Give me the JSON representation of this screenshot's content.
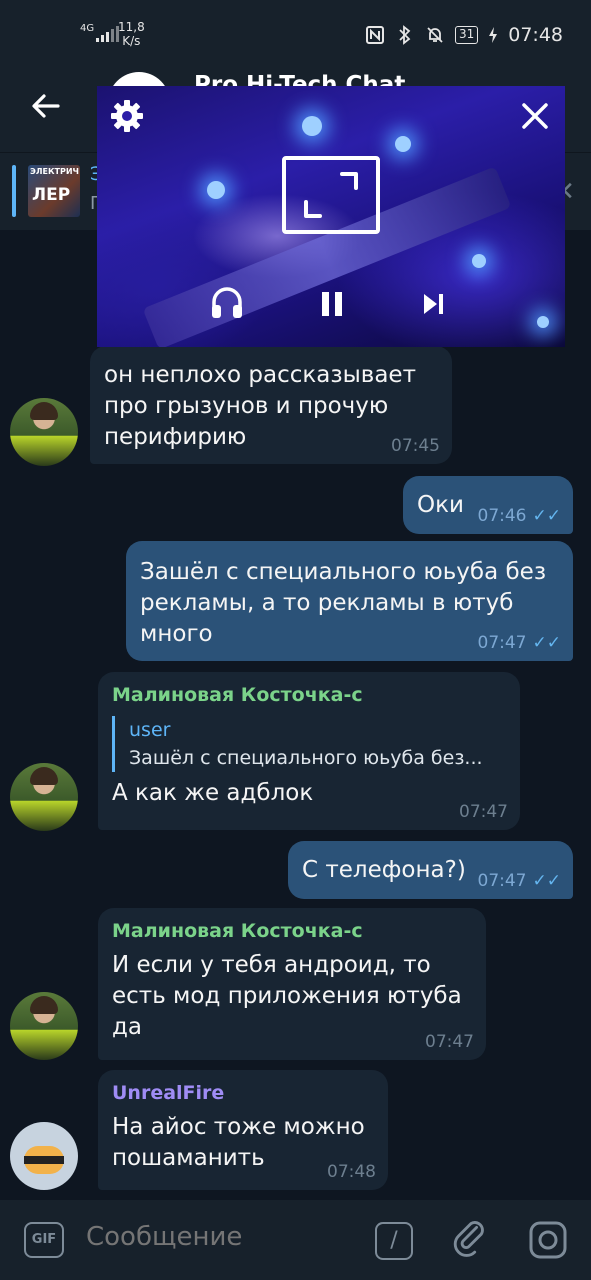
{
  "status_bar": {
    "network": "4G",
    "speed_top": "11,8",
    "speed_bottom": "K/s",
    "battery": "31",
    "time": "07:48"
  },
  "header": {
    "title": "Pro Hi-Tech Chat"
  },
  "pinned": {
    "title": "Э",
    "text": "Г",
    "thumb_top": "ЭЛЕКТРИЧ",
    "thumb_big": "ЛЕР"
  },
  "pip": {
    "icons": [
      "gear-icon",
      "close-icon",
      "expand-icon",
      "headphones-icon",
      "pause-icon",
      "next-icon"
    ]
  },
  "messages": [
    {
      "text": "он неплохо рассказывает про грызунов и прочую перифирию",
      "time": "07:45"
    },
    {
      "text": "Оки",
      "time": "07:46",
      "read": "✓✓"
    },
    {
      "text": "Зашёл с специального юьуба без рекламы, а то рекламы в ютуб много",
      "time": "07:47",
      "read": "✓✓"
    },
    {
      "sender": "Малиновая Косточка-с",
      "reply_name": "user",
      "reply_text": "Зашёл с специального юьуба без...",
      "text": "А как же адблок",
      "time": "07:47"
    },
    {
      "text": "С телефона?)",
      "time": "07:47",
      "read": "✓✓"
    },
    {
      "sender": "Малиновая Косточка-с",
      "text": "И если у тебя андроид, то есть мод приложения ютуба да",
      "time": "07:47"
    },
    {
      "sender": "UnrealFire",
      "text": "На айос тоже можно пошаманить",
      "time": "07:48"
    }
  ],
  "colors": {
    "background": "#0e1621",
    "incoming": "#182533",
    "outgoing": "#2b5278",
    "sender_green": "#7bd38a",
    "sender_purple": "#9f8cf5",
    "accent": "#5eb5f7"
  },
  "input": {
    "gif_label": "GIF",
    "placeholder": "Сообщение",
    "command_label": "/"
  }
}
